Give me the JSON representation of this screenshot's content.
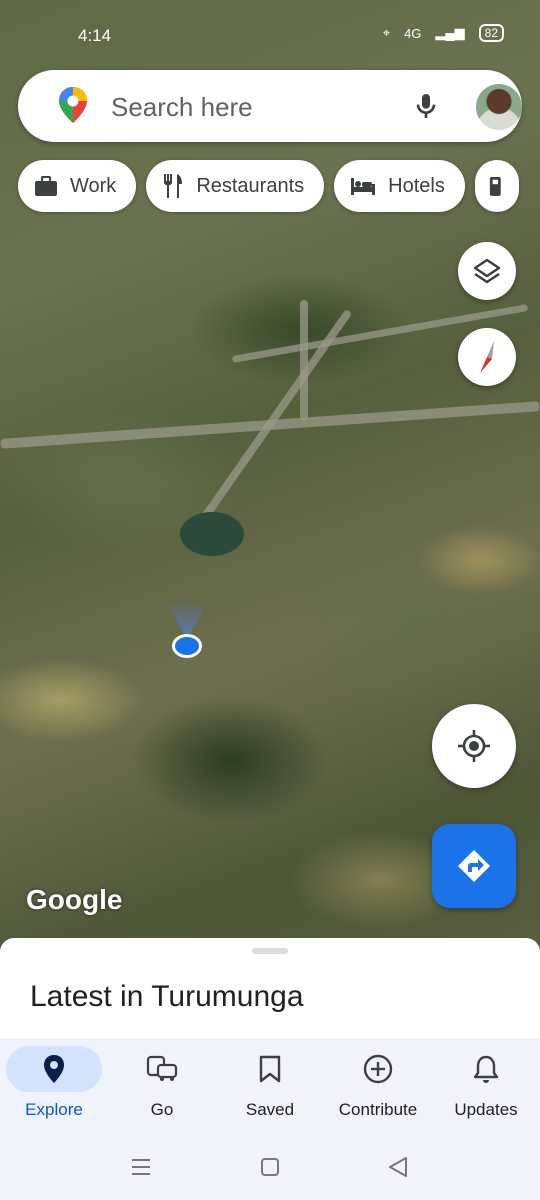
{
  "status_bar": {
    "time": "4:14",
    "network": "4G",
    "battery": "82"
  },
  "search": {
    "placeholder": "Search here"
  },
  "chips": [
    {
      "label": "Work",
      "icon": "briefcase-icon"
    },
    {
      "label": "Restaurants",
      "icon": "fork-knife-icon"
    },
    {
      "label": "Hotels",
      "icon": "bed-icon"
    },
    {
      "label": "",
      "icon": "gas-station-icon"
    }
  ],
  "map": {
    "attribution": "Google"
  },
  "sheet": {
    "title": "Latest in Turumunga"
  },
  "bottom_nav": [
    {
      "label": "Explore",
      "icon": "location-pin-icon",
      "active": true
    },
    {
      "label": "Go",
      "icon": "commute-icon",
      "active": false
    },
    {
      "label": "Saved",
      "icon": "bookmark-icon",
      "active": false
    },
    {
      "label": "Contribute",
      "icon": "add-circle-icon",
      "active": false
    },
    {
      "label": "Updates",
      "icon": "bell-icon",
      "active": false
    }
  ],
  "colors": {
    "accent": "#1a73e8",
    "nav_active_bg": "#d3e3fd",
    "nav_bg": "#f0f3fb"
  }
}
